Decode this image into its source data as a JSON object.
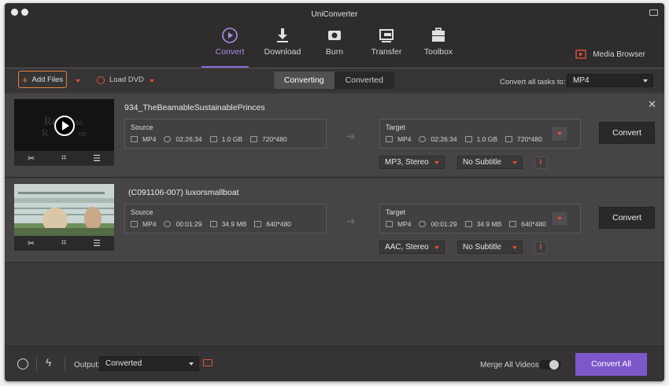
{
  "app": {
    "title": "UniConverter"
  },
  "nav": {
    "tabs": [
      {
        "label": "Convert",
        "active": true
      },
      {
        "label": "Download"
      },
      {
        "label": "Burn"
      },
      {
        "label": "Transfer"
      },
      {
        "label": "Toolbox"
      }
    ],
    "media_browser": "Media Browser"
  },
  "toolbar": {
    "add_files": "Add Files",
    "load_dvd": "Load DVD",
    "segments": [
      "Converting",
      "Converted"
    ],
    "convert_all_label": "Convert all tasks to:",
    "convert_all_value": "MP4"
  },
  "tasks": [
    {
      "title": "934_TheBeamableSustainablePrinces",
      "source": {
        "label": "Source",
        "format": "MP4",
        "duration": "02:26:34",
        "size": "1.0 GB",
        "resolution": "720*480"
      },
      "target": {
        "label": "Target",
        "format": "MP4",
        "duration": "02:26:34",
        "size": "1.0 GB",
        "resolution": "720*480"
      },
      "audio": "MP3, Stereo",
      "subtitle": "No Subtitle",
      "convert": "Convert"
    },
    {
      "title": "(C091106-007)  luxorsmallboat",
      "source": {
        "label": "Source",
        "format": "MP4",
        "duration": "00:01:29",
        "size": "34.9 MB",
        "resolution": "640*480"
      },
      "target": {
        "label": "Target",
        "format": "MP4",
        "duration": "00:01:29",
        "size": "34.9 MB",
        "resolution": "640*480"
      },
      "audio": "AAC, Stereo",
      "subtitle": "No Subtitle",
      "convert": "Convert"
    }
  ],
  "footer": {
    "output_label": "Output:",
    "output_value": "Converted",
    "merge_label": "Merge All Videos:",
    "merge_on": false,
    "convert_all": "Convert All"
  },
  "colors": {
    "accent": "#7d58c9",
    "highlight": "#e3843b",
    "warning": "#e0523a"
  }
}
